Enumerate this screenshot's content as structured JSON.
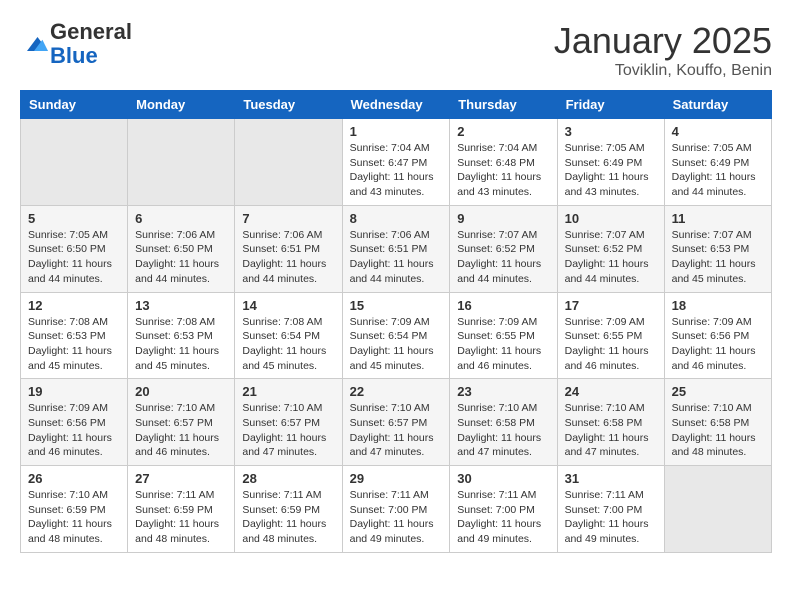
{
  "header": {
    "logo_general": "General",
    "logo_blue": "Blue",
    "month_title": "January 2025",
    "location": "Toviklin, Kouffo, Benin"
  },
  "days_of_week": [
    "Sunday",
    "Monday",
    "Tuesday",
    "Wednesday",
    "Thursday",
    "Friday",
    "Saturday"
  ],
  "weeks": [
    [
      {
        "day": "",
        "info": ""
      },
      {
        "day": "",
        "info": ""
      },
      {
        "day": "",
        "info": ""
      },
      {
        "day": "1",
        "info": "Sunrise: 7:04 AM\nSunset: 6:47 PM\nDaylight: 11 hours and 43 minutes."
      },
      {
        "day": "2",
        "info": "Sunrise: 7:04 AM\nSunset: 6:48 PM\nDaylight: 11 hours and 43 minutes."
      },
      {
        "day": "3",
        "info": "Sunrise: 7:05 AM\nSunset: 6:49 PM\nDaylight: 11 hours and 43 minutes."
      },
      {
        "day": "4",
        "info": "Sunrise: 7:05 AM\nSunset: 6:49 PM\nDaylight: 11 hours and 44 minutes."
      }
    ],
    [
      {
        "day": "5",
        "info": "Sunrise: 7:05 AM\nSunset: 6:50 PM\nDaylight: 11 hours and 44 minutes."
      },
      {
        "day": "6",
        "info": "Sunrise: 7:06 AM\nSunset: 6:50 PM\nDaylight: 11 hours and 44 minutes."
      },
      {
        "day": "7",
        "info": "Sunrise: 7:06 AM\nSunset: 6:51 PM\nDaylight: 11 hours and 44 minutes."
      },
      {
        "day": "8",
        "info": "Sunrise: 7:06 AM\nSunset: 6:51 PM\nDaylight: 11 hours and 44 minutes."
      },
      {
        "day": "9",
        "info": "Sunrise: 7:07 AM\nSunset: 6:52 PM\nDaylight: 11 hours and 44 minutes."
      },
      {
        "day": "10",
        "info": "Sunrise: 7:07 AM\nSunset: 6:52 PM\nDaylight: 11 hours and 44 minutes."
      },
      {
        "day": "11",
        "info": "Sunrise: 7:07 AM\nSunset: 6:53 PM\nDaylight: 11 hours and 45 minutes."
      }
    ],
    [
      {
        "day": "12",
        "info": "Sunrise: 7:08 AM\nSunset: 6:53 PM\nDaylight: 11 hours and 45 minutes."
      },
      {
        "day": "13",
        "info": "Sunrise: 7:08 AM\nSunset: 6:53 PM\nDaylight: 11 hours and 45 minutes."
      },
      {
        "day": "14",
        "info": "Sunrise: 7:08 AM\nSunset: 6:54 PM\nDaylight: 11 hours and 45 minutes."
      },
      {
        "day": "15",
        "info": "Sunrise: 7:09 AM\nSunset: 6:54 PM\nDaylight: 11 hours and 45 minutes."
      },
      {
        "day": "16",
        "info": "Sunrise: 7:09 AM\nSunset: 6:55 PM\nDaylight: 11 hours and 46 minutes."
      },
      {
        "day": "17",
        "info": "Sunrise: 7:09 AM\nSunset: 6:55 PM\nDaylight: 11 hours and 46 minutes."
      },
      {
        "day": "18",
        "info": "Sunrise: 7:09 AM\nSunset: 6:56 PM\nDaylight: 11 hours and 46 minutes."
      }
    ],
    [
      {
        "day": "19",
        "info": "Sunrise: 7:09 AM\nSunset: 6:56 PM\nDaylight: 11 hours and 46 minutes."
      },
      {
        "day": "20",
        "info": "Sunrise: 7:10 AM\nSunset: 6:57 PM\nDaylight: 11 hours and 46 minutes."
      },
      {
        "day": "21",
        "info": "Sunrise: 7:10 AM\nSunset: 6:57 PM\nDaylight: 11 hours and 47 minutes."
      },
      {
        "day": "22",
        "info": "Sunrise: 7:10 AM\nSunset: 6:57 PM\nDaylight: 11 hours and 47 minutes."
      },
      {
        "day": "23",
        "info": "Sunrise: 7:10 AM\nSunset: 6:58 PM\nDaylight: 11 hours and 47 minutes."
      },
      {
        "day": "24",
        "info": "Sunrise: 7:10 AM\nSunset: 6:58 PM\nDaylight: 11 hours and 47 minutes."
      },
      {
        "day": "25",
        "info": "Sunrise: 7:10 AM\nSunset: 6:58 PM\nDaylight: 11 hours and 48 minutes."
      }
    ],
    [
      {
        "day": "26",
        "info": "Sunrise: 7:10 AM\nSunset: 6:59 PM\nDaylight: 11 hours and 48 minutes."
      },
      {
        "day": "27",
        "info": "Sunrise: 7:11 AM\nSunset: 6:59 PM\nDaylight: 11 hours and 48 minutes."
      },
      {
        "day": "28",
        "info": "Sunrise: 7:11 AM\nSunset: 6:59 PM\nDaylight: 11 hours and 48 minutes."
      },
      {
        "day": "29",
        "info": "Sunrise: 7:11 AM\nSunset: 7:00 PM\nDaylight: 11 hours and 49 minutes."
      },
      {
        "day": "30",
        "info": "Sunrise: 7:11 AM\nSunset: 7:00 PM\nDaylight: 11 hours and 49 minutes."
      },
      {
        "day": "31",
        "info": "Sunrise: 7:11 AM\nSunset: 7:00 PM\nDaylight: 11 hours and 49 minutes."
      },
      {
        "day": "",
        "info": ""
      }
    ]
  ]
}
